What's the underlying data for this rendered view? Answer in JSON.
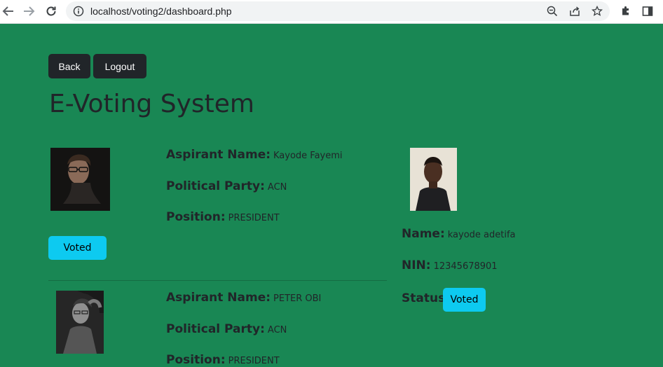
{
  "browser": {
    "url": "localhost/voting2/dashboard.php"
  },
  "header": {
    "back_label": "Back",
    "logout_label": "Logout",
    "title": "E-Voting System"
  },
  "candidates": [
    {
      "name_label": "Aspirant Name:",
      "name": "Kayode Fayemi",
      "party_label": "Political Party:",
      "party": "ACN",
      "position_label": "Position:",
      "position": "PRESIDENT",
      "button_label": "Voted"
    },
    {
      "name_label": "Aspirant Name:",
      "name": "PETER OBI",
      "party_label": "Political Party:",
      "party": "ACN",
      "position_label": "Position:",
      "position": "PRESIDENT"
    }
  ],
  "voter": {
    "name_label": "Name:",
    "name": "kayode adetifa",
    "nin_label": "NIN:",
    "nin": "12345678901",
    "status_label": "Status:",
    "status": "Voted"
  },
  "colors": {
    "background": "#198754",
    "dark_button": "#212529",
    "info_button": "#0dcaf0"
  }
}
